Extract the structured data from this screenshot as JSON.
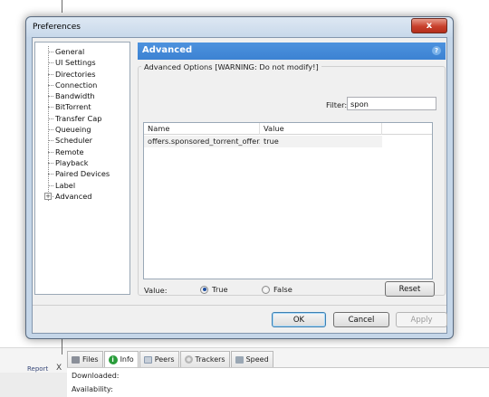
{
  "dialog": {
    "title": "Preferences",
    "close_label": "x",
    "tree_items": [
      {
        "label": "General"
      },
      {
        "label": "UI Settings"
      },
      {
        "label": "Directories"
      },
      {
        "label": "Connection"
      },
      {
        "label": "Bandwidth"
      },
      {
        "label": "BitTorrent"
      },
      {
        "label": "Transfer Cap"
      },
      {
        "label": "Queueing"
      },
      {
        "label": "Scheduler"
      },
      {
        "label": "Remote"
      },
      {
        "label": "Playback"
      },
      {
        "label": "Paired Devices"
      },
      {
        "label": "Label"
      },
      {
        "label": "Advanced",
        "expandable": true
      }
    ],
    "expand_glyph": "+",
    "panel_title": "Advanced",
    "help_glyph": "?",
    "group_title": "Advanced Options [WARNING: Do not modify!]",
    "filter_label": "Filter:",
    "filter_value": "spon",
    "columns": [
      "Name",
      "Value"
    ],
    "rows": [
      {
        "name": "offers.sponsored_torrent_offer...",
        "value": "true"
      }
    ],
    "value_label": "Value:",
    "radio_true": "True",
    "radio_false": "False",
    "selected_value": "True",
    "reset_label": "Reset",
    "ok_label": "OK",
    "cancel_label": "Cancel",
    "apply_label": "Apply"
  },
  "background": {
    "report_label": "Report",
    "report_close": "X",
    "tabs": [
      {
        "label": "Files",
        "icon": "files-icon"
      },
      {
        "label": "Info",
        "icon": "info-icon"
      },
      {
        "label": "Peers",
        "icon": "peers-icon"
      },
      {
        "label": "Trackers",
        "icon": "trackers-icon"
      },
      {
        "label": "Speed",
        "icon": "speed-icon"
      }
    ],
    "active_tab": "Info",
    "info_icon_glyph": "i",
    "downloaded_label": "Downloaded:",
    "availability_label": "Availability:"
  },
  "colors": {
    "header_blue": "#3c82d2",
    "close_red": "#c8402c",
    "window_frame": "#c5d6e8"
  }
}
